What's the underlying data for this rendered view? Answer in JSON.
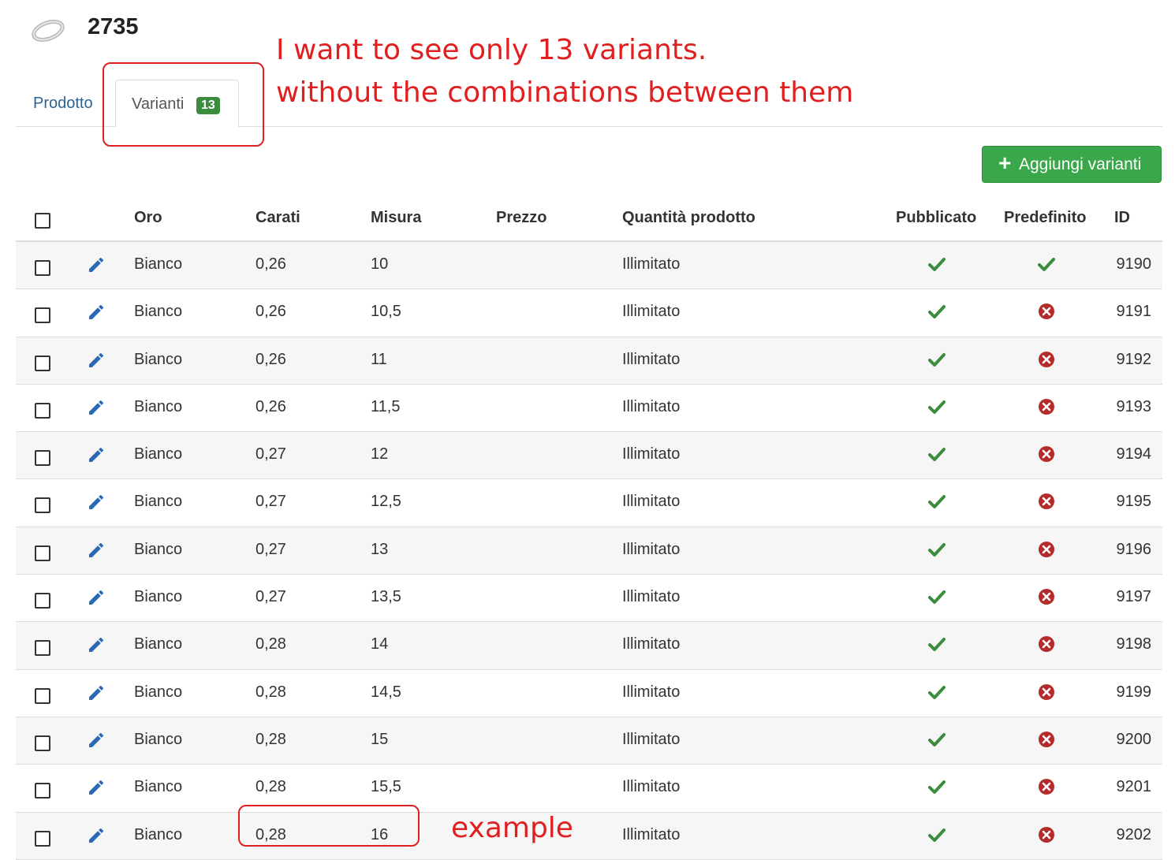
{
  "product": {
    "title": "2735"
  },
  "tabs": [
    {
      "label": "Prodotto"
    },
    {
      "label": "Varianti",
      "badge": "13"
    }
  ],
  "toolbar": {
    "add_button_label": "Aggiungi varianti"
  },
  "table": {
    "headers": [
      "Oro",
      "Carati",
      "Misura",
      "Prezzo",
      "Quantità prodotto",
      "Pubblicato",
      "Predefinito",
      "ID"
    ],
    "rows": [
      {
        "oro": "Bianco",
        "carati": "0,26",
        "misura": "10",
        "prezzo": "",
        "quantita": "Illimitato",
        "pubblicato": true,
        "predefinito": true,
        "id": "9190"
      },
      {
        "oro": "Bianco",
        "carati": "0,26",
        "misura": "10,5",
        "prezzo": "",
        "quantita": "Illimitato",
        "pubblicato": true,
        "predefinito": false,
        "id": "9191"
      },
      {
        "oro": "Bianco",
        "carati": "0,26",
        "misura": "11",
        "prezzo": "",
        "quantita": "Illimitato",
        "pubblicato": true,
        "predefinito": false,
        "id": "9192"
      },
      {
        "oro": "Bianco",
        "carati": "0,26",
        "misura": "11,5",
        "prezzo": "",
        "quantita": "Illimitato",
        "pubblicato": true,
        "predefinito": false,
        "id": "9193"
      },
      {
        "oro": "Bianco",
        "carati": "0,27",
        "misura": "12",
        "prezzo": "",
        "quantita": "Illimitato",
        "pubblicato": true,
        "predefinito": false,
        "id": "9194"
      },
      {
        "oro": "Bianco",
        "carati": "0,27",
        "misura": "12,5",
        "prezzo": "",
        "quantita": "Illimitato",
        "pubblicato": true,
        "predefinito": false,
        "id": "9195"
      },
      {
        "oro": "Bianco",
        "carati": "0,27",
        "misura": "13",
        "prezzo": "",
        "quantita": "Illimitato",
        "pubblicato": true,
        "predefinito": false,
        "id": "9196"
      },
      {
        "oro": "Bianco",
        "carati": "0,27",
        "misura": "13,5",
        "prezzo": "",
        "quantita": "Illimitato",
        "pubblicato": true,
        "predefinito": false,
        "id": "9197"
      },
      {
        "oro": "Bianco",
        "carati": "0,28",
        "misura": "14",
        "prezzo": "",
        "quantita": "Illimitato",
        "pubblicato": true,
        "predefinito": false,
        "id": "9198"
      },
      {
        "oro": "Bianco",
        "carati": "0,28",
        "misura": "14,5",
        "prezzo": "",
        "quantita": "Illimitato",
        "pubblicato": true,
        "predefinito": false,
        "id": "9199"
      },
      {
        "oro": "Bianco",
        "carati": "0,28",
        "misura": "15",
        "prezzo": "",
        "quantita": "Illimitato",
        "pubblicato": true,
        "predefinito": false,
        "id": "9200"
      },
      {
        "oro": "Bianco",
        "carati": "0,28",
        "misura": "15,5",
        "prezzo": "",
        "quantita": "Illimitato",
        "pubblicato": true,
        "predefinito": false,
        "id": "9201"
      },
      {
        "oro": "Bianco",
        "carati": "0,28",
        "misura": "16",
        "prezzo": "",
        "quantita": "Illimitato",
        "pubblicato": true,
        "predefinito": false,
        "id": "9202"
      }
    ]
  },
  "annotations": {
    "line1": "I want to see only 13 variants.",
    "line2": "without the combinations between them",
    "example": "example"
  },
  "colors": {
    "accent_link": "#2a6496",
    "success": "#3aa84a",
    "check": "#3c8c3e",
    "error": "#b52b2b",
    "annotation": "#e02020",
    "pencil": "#2a6ab4"
  },
  "icons": {
    "edit": "pencil-icon",
    "published": "check-icon",
    "not_default": "x-circle-icon",
    "thumbnail": "ring-image"
  }
}
